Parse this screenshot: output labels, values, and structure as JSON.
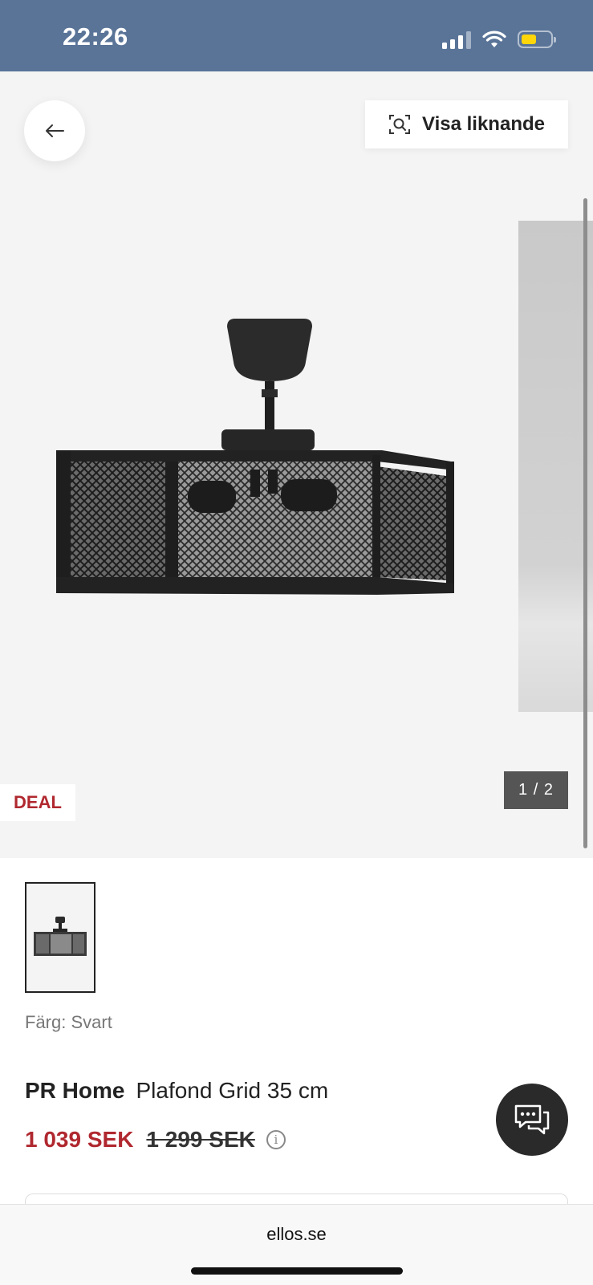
{
  "status_bar": {
    "time": "22:26"
  },
  "hero": {
    "similar_button_label": "Visa liknande",
    "deal_badge": "DEAL",
    "image_counter": "1 / 2"
  },
  "product": {
    "color_label": "Färg:",
    "color_value": "Svart",
    "brand": "PR Home",
    "name": "Plafond Grid 35 cm",
    "price_current": "1 039 SEK",
    "price_original": "1 299 SEK",
    "price_info_icon": "i"
  },
  "browser": {
    "url": "ellos.se"
  },
  "colors": {
    "status_bar_bg": "#5a7498",
    "deal_red": "#b0282f",
    "chat_bg": "#2a2a2a",
    "battery": "#ffd60a"
  },
  "icons": [
    "back-arrow-icon",
    "visual-search-icon",
    "chat-icon",
    "info-icon",
    "signal-icon",
    "wifi-icon",
    "battery-icon"
  ]
}
